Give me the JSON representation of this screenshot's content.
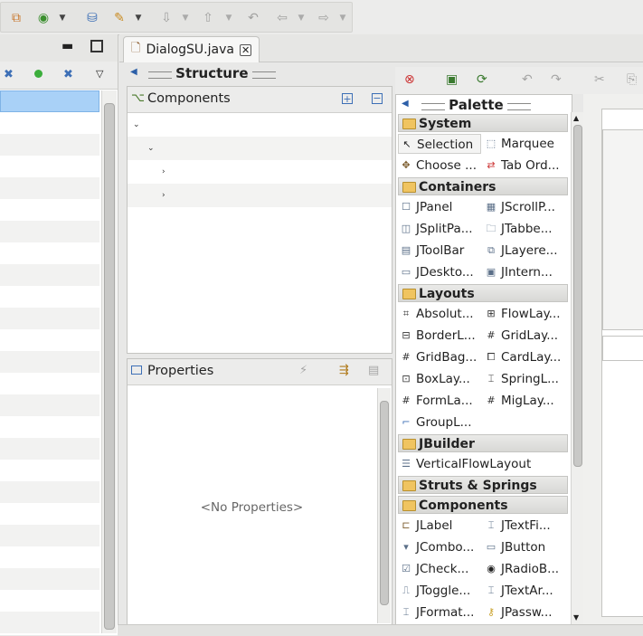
{
  "toolbar": {
    "icons": [
      "package-icon",
      "refresh-run-icon",
      "connect-icon",
      "debug-tool-icon",
      "next-annotation-icon",
      "prev-annotation-icon",
      "last-edit-icon",
      "back-icon",
      "forward-icon"
    ]
  },
  "editor": {
    "tab_label": "DialogSU.java",
    "tab_close": "✕"
  },
  "structure": {
    "title": "Structure",
    "components_label": "Components",
    "expand_all": "+",
    "collapse_all": "−"
  },
  "properties": {
    "label": "Properties",
    "empty_text": "<No Properties>"
  },
  "palette": {
    "title": "Palette",
    "categories": {
      "system": "System",
      "containers": "Containers",
      "layouts": "Layouts",
      "jbuilder": "JBuilder",
      "struts": "Struts & Springs",
      "components": "Components"
    },
    "items": {
      "selection": "Selection",
      "marquee": "Marquee",
      "choose": "Choose ...",
      "tab_order": "Tab Ord...",
      "jpanel": "JPanel",
      "jscrollpane": "JScrollP...",
      "jsplitpane": "JSplitPa...",
      "jtabbedpane": "JTabbe...",
      "jtoolbar": "JToolBar",
      "jlayered": "JLayere...",
      "jdesktop": "JDeskto...",
      "jinternal": "JIntern...",
      "absolute": "Absolut...",
      "flowlayout": "FlowLay...",
      "borderlayout": "BorderL...",
      "gridlayout": "GridLay...",
      "gridbag": "GridBag...",
      "cardlayout": "CardLay...",
      "boxlayout": "BoxLay...",
      "springlayout": "SpringL...",
      "formlayout": "FormLa...",
      "miglayout": "MigLay...",
      "grouplayout": "GroupL...",
      "verticalflow": "VerticalFlowLayout",
      "jlabel": "JLabel",
      "jtextfield": "JTextFi...",
      "jcombobox": "JCombo...",
      "jbutton": "JButton",
      "jcheckbox": "JCheck...",
      "jradiobutton": "JRadioB...",
      "jtogglebutton": "JToggle...",
      "jtextarea": "JTextAr...",
      "jformatted": "JFormat...",
      "jpassword": "JPassw..."
    }
  },
  "colors": {
    "selection_row": "#a9d1f7",
    "folder": "#f0c460"
  }
}
